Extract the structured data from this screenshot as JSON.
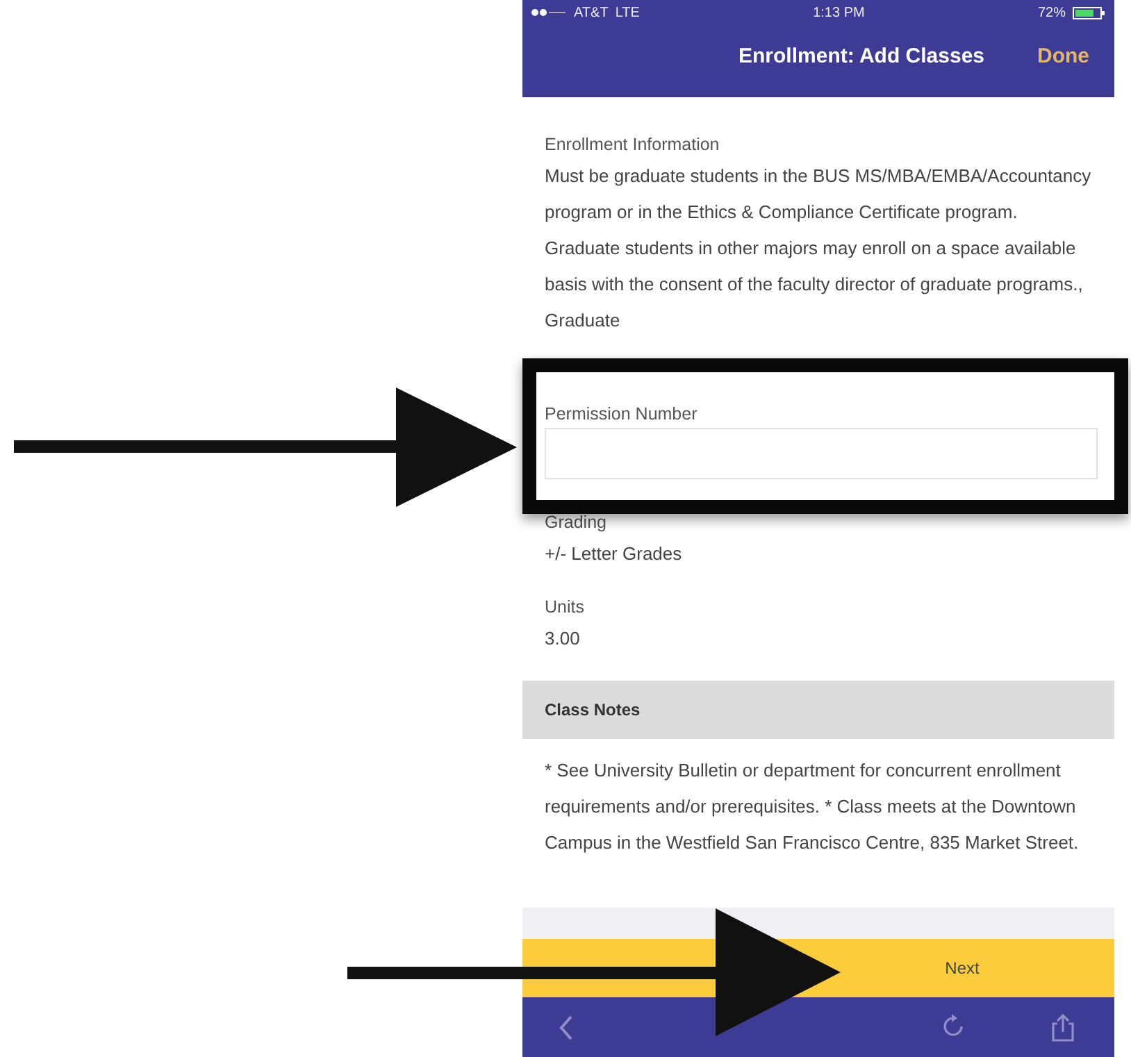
{
  "status_bar": {
    "carrier": "AT&T",
    "network": "LTE",
    "time": "1:13 PM",
    "battery": "72%"
  },
  "nav_bar": {
    "title": "Enrollment: Add Classes",
    "done": "Done"
  },
  "fields": [
    {
      "kind": "info",
      "label": "Enrollment Information",
      "value": "Must be graduate students in the BUS MS/MBA/EMBA/Accountancy program or in the Ethics & Compliance Certificate program. Graduate students in other majors may enroll on a space available basis with the consent of the faculty director of graduate programs., Graduate"
    },
    {
      "kind": "input",
      "label": "Permission Number"
    },
    {
      "kind": "info",
      "label": "Grading",
      "value": "+/- Letter Grades"
    },
    {
      "kind": "info",
      "label": "Units",
      "value": "3.00"
    }
  ],
  "class_notes": {
    "heading": "Class Notes",
    "text": "* See University Bulletin or department for concurrent enrollment requirements and/or prerequisites. * Class meets at the Downtown Campus in the Westfield San Francisco Centre, 835 Market Street."
  },
  "action_bar": {
    "next": "Next"
  },
  "annotations": [
    {
      "kind": "highlight"
    },
    {
      "kind": "arrow"
    },
    {
      "kind": "arrow"
    }
  ]
}
